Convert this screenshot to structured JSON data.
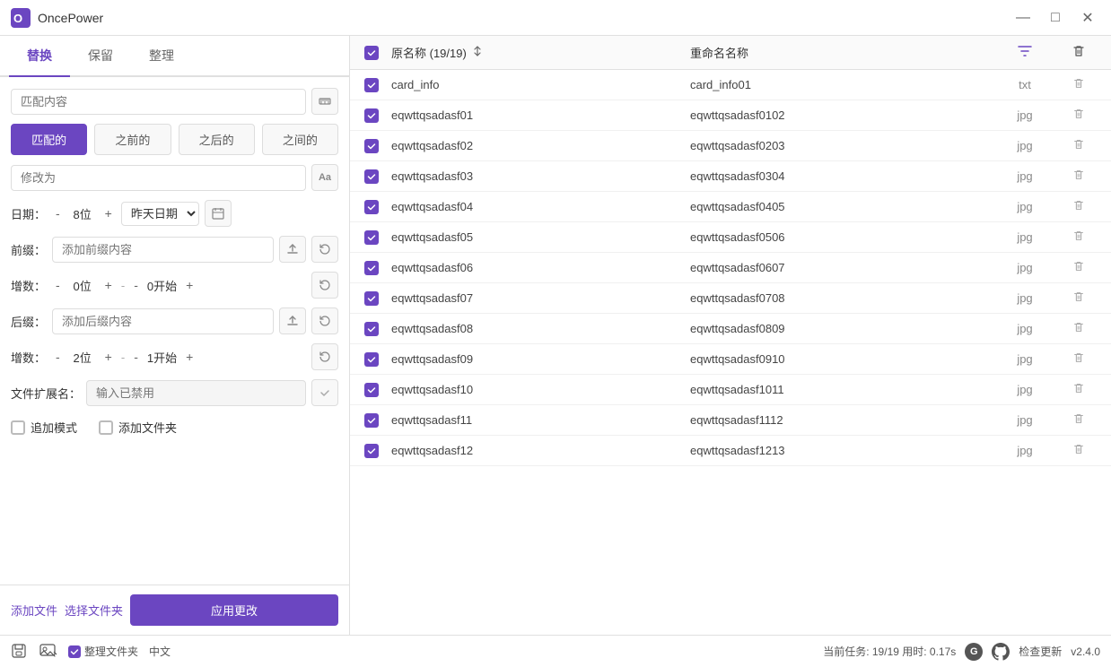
{
  "app": {
    "name": "OncePower",
    "version": "v2.4.0"
  },
  "titlebar": {
    "title": "OncePower",
    "minimize": "—",
    "maximize": "□",
    "close": "✕"
  },
  "tabs": {
    "items": [
      "替换",
      "保留",
      "整理"
    ],
    "active": 0
  },
  "left": {
    "match_placeholder": "匹配内容",
    "mode_buttons": [
      "匹配的",
      "之前的",
      "之后的",
      "之间的"
    ],
    "active_mode": 0,
    "modify_placeholder": "修改为",
    "date_label": "日期：",
    "date_minus": "-",
    "date_bits": "8位",
    "date_plus": "+",
    "date_value": "昨天日期",
    "prefix_label": "前缀：",
    "prefix_placeholder": "添加前缀内容",
    "inc1_label": "增数：",
    "inc1_minus1": "-",
    "inc1_bits": "0位",
    "inc1_plus1": "+",
    "inc1_minus2": "-",
    "inc1_start": "0开始",
    "inc1_plus2": "+",
    "suffix_label": "后缀：",
    "suffix_placeholder": "添加后缀内容",
    "inc2_label": "增数：",
    "inc2_minus1": "-",
    "inc2_bits": "2位",
    "inc2_plus1": "+",
    "inc2_minus2": "-",
    "inc2_start": "1开始",
    "inc2_plus2": "+",
    "ext_label": "文件扩展名：",
    "ext_placeholder": "输入已禁用",
    "check1_label": "追加模式",
    "check2_label": "添加文件夹",
    "btn_add_file": "添加文件",
    "btn_select_folder": "选择文件夹",
    "btn_apply": "应用更改"
  },
  "statusbar": {
    "folder_label": "整理文件夹",
    "lang": "中文",
    "task_info": "当前任务: 19/19  用时: 0.17s",
    "check_update": "检查更新",
    "version": "v2.4.0"
  },
  "file_list": {
    "header": {
      "original_name": "原名称 (19/19)",
      "rename": "重命名名称",
      "ext": "",
      "filter_icon": true,
      "delete_icon": true
    },
    "files": [
      {
        "id": 1,
        "original": "card_info",
        "rename": "card_info01",
        "ext": "txt",
        "checked": true
      },
      {
        "id": 2,
        "original": "eqwttqsadasf01",
        "rename": "eqwttqsadasf0102",
        "ext": "jpg",
        "checked": true
      },
      {
        "id": 3,
        "original": "eqwttqsadasf02",
        "rename": "eqwttqsadasf0203",
        "ext": "jpg",
        "checked": true
      },
      {
        "id": 4,
        "original": "eqwttqsadasf03",
        "rename": "eqwttqsadasf0304",
        "ext": "jpg",
        "checked": true
      },
      {
        "id": 5,
        "original": "eqwttqsadasf04",
        "rename": "eqwttqsadasf0405",
        "ext": "jpg",
        "checked": true
      },
      {
        "id": 6,
        "original": "eqwttqsadasf05",
        "rename": "eqwttqsadasf0506",
        "ext": "jpg",
        "checked": true
      },
      {
        "id": 7,
        "original": "eqwttqsadasf06",
        "rename": "eqwttqsadasf0607",
        "ext": "jpg",
        "checked": true
      },
      {
        "id": 8,
        "original": "eqwttqsadasf07",
        "rename": "eqwttqsadasf0708",
        "ext": "jpg",
        "checked": true
      },
      {
        "id": 9,
        "original": "eqwttqsadasf08",
        "rename": "eqwttqsadasf0809",
        "ext": "jpg",
        "checked": true
      },
      {
        "id": 10,
        "original": "eqwttqsadasf09",
        "rename": "eqwttqsadasf0910",
        "ext": "jpg",
        "checked": true
      },
      {
        "id": 11,
        "original": "eqwttqsadasf10",
        "rename": "eqwttqsadasf1011",
        "ext": "jpg",
        "checked": true
      },
      {
        "id": 12,
        "original": "eqwttqsadasf11",
        "rename": "eqwttqsadasf1112",
        "ext": "jpg",
        "checked": true
      },
      {
        "id": 13,
        "original": "eqwttqsadasf12",
        "rename": "eqwttqsadasf1213",
        "ext": "jpg",
        "checked": true
      }
    ]
  }
}
